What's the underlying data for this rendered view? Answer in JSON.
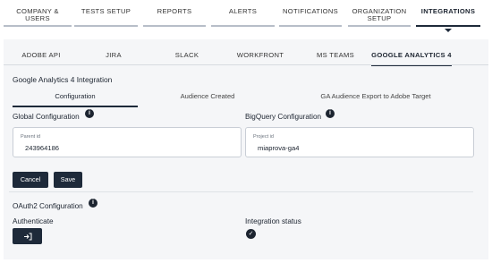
{
  "top_nav": [
    "COMPANY & USERS",
    "TESTS SETUP",
    "REPORTS",
    "ALERTS",
    "NOTIFICATIONS",
    "ORGANIZATION SETUP",
    "INTEGRATIONS"
  ],
  "active_top_tab": "INTEGRATIONS",
  "sub_nav": [
    "ADOBE API",
    "JIRA",
    "SLACK",
    "WORKFRONT",
    "MS TEAMS",
    "GOOGLE ANALYTICS 4"
  ],
  "active_sub_tab": "GOOGLE ANALYTICS 4",
  "section_title": "Google Analytics 4 Integration",
  "content_tabs": [
    "Configuration",
    "Audience Created",
    "GA Audience Export to Adobe Target"
  ],
  "global_config": {
    "heading": "Global Configuration",
    "field_label": "Parent id",
    "field_value": "243964186"
  },
  "bigquery_config": {
    "heading": "BigQuery Configuration",
    "field_label": "Project id",
    "field_value": "miaprova-ga4"
  },
  "buttons": {
    "cancel": "Cancel",
    "save": "Save"
  },
  "oauth": {
    "heading": "OAuth2 Configuration",
    "authenticate_label": "Authenticate",
    "login_icon": "login-icon",
    "status_label": "Integration status",
    "status_icon": "check-circle-icon"
  },
  "colors": {
    "accent": "#1e2a3a",
    "panel_bg": "#f5f6f8"
  }
}
